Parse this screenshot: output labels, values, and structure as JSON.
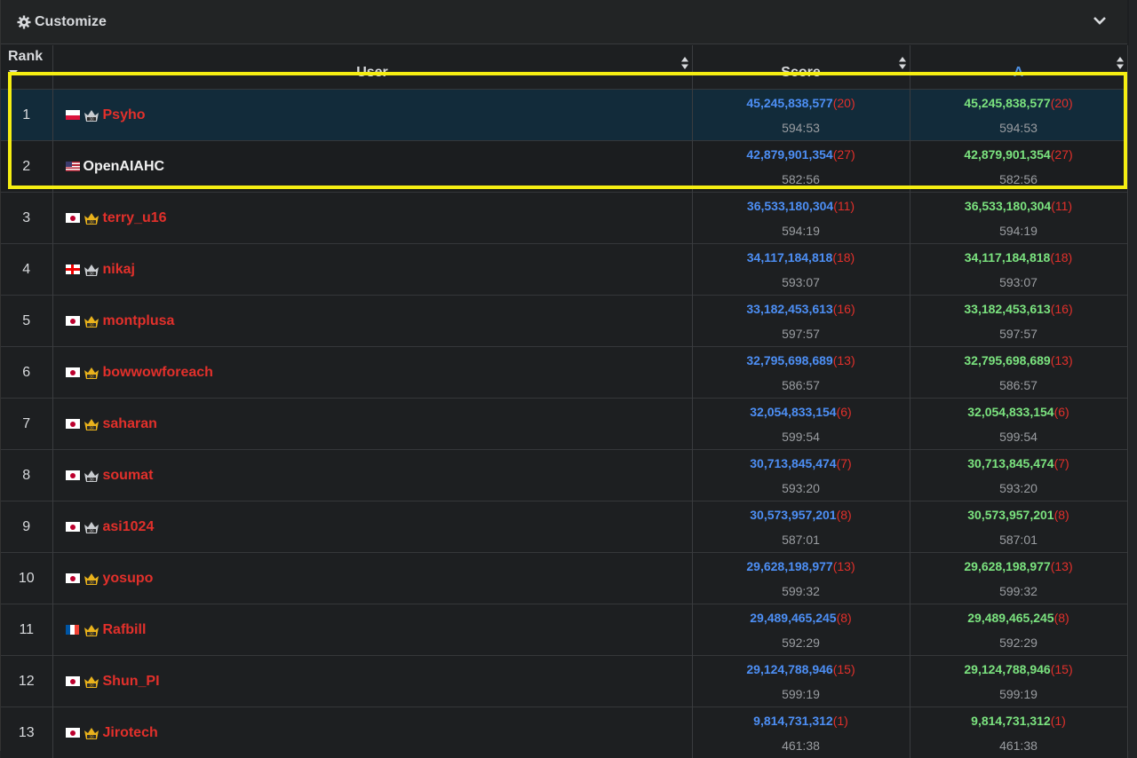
{
  "header": {
    "customize_label": "Customize",
    "icons": {
      "left": "gear-icon",
      "right": "chevron-down-icon"
    }
  },
  "columns": {
    "rank": "Rank",
    "user": "User",
    "score": "Score",
    "a": "A"
  },
  "rows": [
    {
      "rank": "1",
      "flag": "PL",
      "crown": "silver",
      "user": "Psyho",
      "user_color": "red",
      "score": "45,245,838,577",
      "score_count": "(20)",
      "score_time": "594:53",
      "a": "45,245,838,577",
      "a_count": "(20)",
      "a_time": "594:53"
    },
    {
      "rank": "2",
      "flag": "US",
      "crown": "none",
      "user": "OpenAIAHC",
      "user_color": "white",
      "score": "42,879,901,354",
      "score_count": "(27)",
      "score_time": "582:56",
      "a": "42,879,901,354",
      "a_count": "(27)",
      "a_time": "582:56"
    },
    {
      "rank": "3",
      "flag": "JP",
      "crown": "gold",
      "user": "terry_u16",
      "user_color": "red",
      "score": "36,533,180,304",
      "score_count": "(11)",
      "score_time": "594:19",
      "a": "36,533,180,304",
      "a_count": "(11)",
      "a_time": "594:19"
    },
    {
      "rank": "4",
      "flag": "GE",
      "crown": "silver",
      "user": "nikaj",
      "user_color": "red",
      "score": "34,117,184,818",
      "score_count": "(18)",
      "score_time": "593:07",
      "a": "34,117,184,818",
      "a_count": "(18)",
      "a_time": "593:07"
    },
    {
      "rank": "5",
      "flag": "JP",
      "crown": "gold",
      "user": "montplusa",
      "user_color": "red",
      "score": "33,182,453,613",
      "score_count": "(16)",
      "score_time": "597:57",
      "a": "33,182,453,613",
      "a_count": "(16)",
      "a_time": "597:57"
    },
    {
      "rank": "6",
      "flag": "JP",
      "crown": "gold",
      "user": "bowwowforeach",
      "user_color": "red",
      "score": "32,795,698,689",
      "score_count": "(13)",
      "score_time": "586:57",
      "a": "32,795,698,689",
      "a_count": "(13)",
      "a_time": "586:57"
    },
    {
      "rank": "7",
      "flag": "JP",
      "crown": "gold",
      "user": "saharan",
      "user_color": "red",
      "score": "32,054,833,154",
      "score_count": "(6)",
      "score_time": "599:54",
      "a": "32,054,833,154",
      "a_count": "(6)",
      "a_time": "599:54"
    },
    {
      "rank": "8",
      "flag": "JP",
      "crown": "silver",
      "user": "soumat",
      "user_color": "red",
      "score": "30,713,845,474",
      "score_count": "(7)",
      "score_time": "593:20",
      "a": "30,713,845,474",
      "a_count": "(7)",
      "a_time": "593:20"
    },
    {
      "rank": "9",
      "flag": "JP",
      "crown": "silver",
      "user": "asi1024",
      "user_color": "red",
      "score": "30,573,957,201",
      "score_count": "(8)",
      "score_time": "587:01",
      "a": "30,573,957,201",
      "a_count": "(8)",
      "a_time": "587:01"
    },
    {
      "rank": "10",
      "flag": "JP",
      "crown": "gold",
      "user": "yosupo",
      "user_color": "red",
      "score": "29,628,198,977",
      "score_count": "(13)",
      "score_time": "599:32",
      "a": "29,628,198,977",
      "a_count": "(13)",
      "a_time": "599:32"
    },
    {
      "rank": "11",
      "flag": "FR",
      "crown": "gold",
      "user": "Rafbill",
      "user_color": "red",
      "score": "29,489,465,245",
      "score_count": "(8)",
      "score_time": "592:29",
      "a": "29,489,465,245",
      "a_count": "(8)",
      "a_time": "592:29"
    },
    {
      "rank": "12",
      "flag": "JP",
      "crown": "gold",
      "user": "Shun_PI",
      "user_color": "red",
      "score": "29,124,788,946",
      "score_count": "(15)",
      "score_time": "599:19",
      "a": "29,124,788,946",
      "a_count": "(15)",
      "a_time": "599:19"
    },
    {
      "rank": "13",
      "flag": "JP",
      "crown": "gold",
      "user": "Jirotech",
      "user_color": "red",
      "score": "9,814,731,312",
      "score_count": "(1)",
      "score_time": "461:38",
      "a": "9,814,731,312",
      "a_count": "(1)",
      "a_time": "461:38"
    }
  ],
  "colors": {
    "score_blue": "#4d8ff5",
    "a_green": "#7be37f",
    "count_red": "#e2302b",
    "highlight_yellow": "#f5ee12",
    "selected_row": "#122b3a"
  }
}
